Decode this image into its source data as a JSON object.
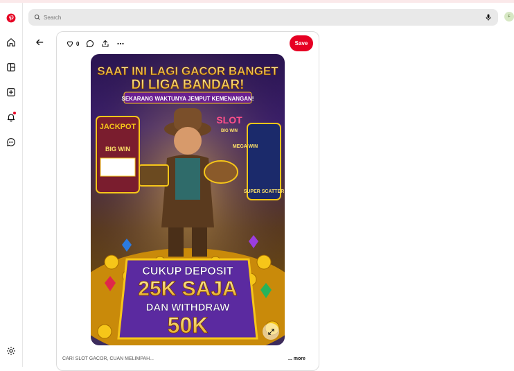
{
  "search": {
    "placeholder": "Search"
  },
  "user": {
    "avatar_letter": "F"
  },
  "pin": {
    "like_count": "0",
    "save_label": "Save",
    "caption": "CARI SLOT GACOR, CUAN MELIMPAH...",
    "more_label": "... more",
    "image_text": {
      "headline_1": "SAAT INI LAGI GACOR BANGET",
      "headline_2": "DI LIGA BANDAR!",
      "tagline": "SEKARANG WAKTUNYA JEMPUT KEMENANGAN!",
      "jackpot": "JACKPOT",
      "big_win": "BIG WIN",
      "slot": "SLOT",
      "slot_big_win": "BIG WIN",
      "mega_win": "MEGA WIN",
      "super_scatter": "SUPER SCATTER",
      "deposit_1": "CUKUP DEPOSIT",
      "deposit_2": "25K SAJA",
      "withdraw_1": "DAN WITHDRAW",
      "withdraw_2": "50K"
    }
  },
  "colors": {
    "brand": "#e60023",
    "search_bg": "#e9e9e9",
    "gold": "#f6c619"
  }
}
